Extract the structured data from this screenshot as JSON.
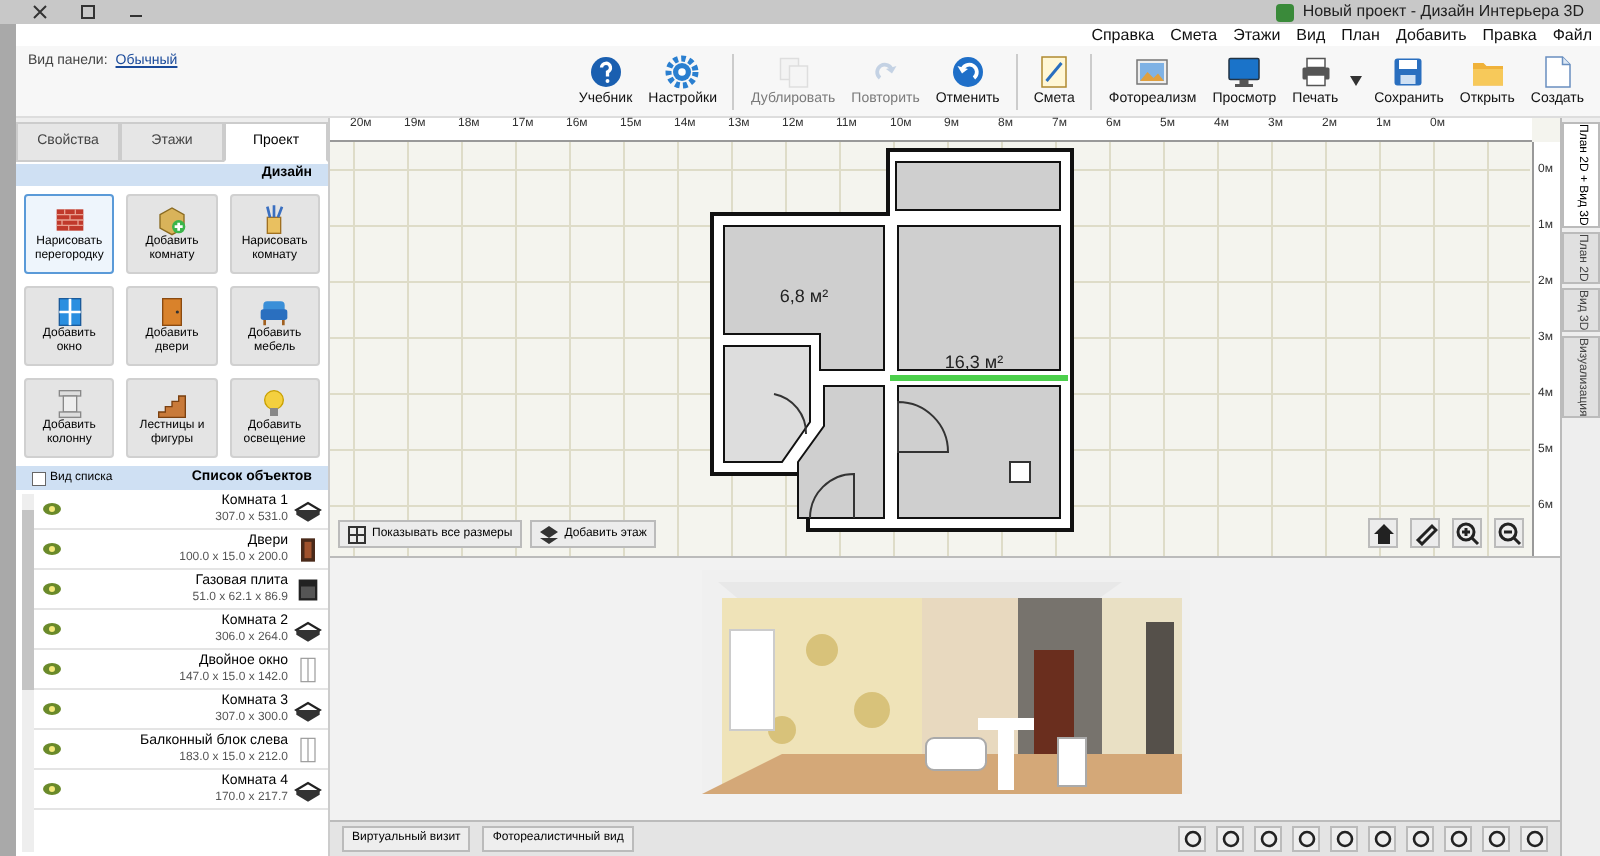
{
  "window": {
    "title": "Новый проект - Дизайн Интерьера 3D"
  },
  "menu": [
    "Справка",
    "Смета",
    "Этажи",
    "Вид",
    "План",
    "Добавить",
    "Правка",
    "Файл"
  ],
  "toolbar": [
    {
      "label": "Учебник",
      "kind": "help",
      "disabled": false
    },
    {
      "label": "Настройки",
      "kind": "settings",
      "disabled": false
    },
    {
      "label": "Дублировать",
      "kind": "duplicate",
      "disabled": true
    },
    {
      "label": "Повторить",
      "kind": "redo",
      "disabled": true
    },
    {
      "label": "Отменить",
      "kind": "undo",
      "disabled": false
    },
    {
      "label": "Смета",
      "kind": "estimate",
      "disabled": false
    },
    {
      "label": "Фотореализм",
      "disabled": false
    },
    {
      "label": "Просмотр",
      "kind": "preview",
      "disabled": false
    },
    {
      "label": "Печать",
      "kind": "print",
      "disabled": false
    },
    {
      "label": "Сохранить",
      "kind": "save",
      "disabled": false
    },
    {
      "label": "Открыть",
      "kind": "open",
      "disabled": false
    },
    {
      "label": "Создать",
      "kind": "new",
      "disabled": false
    }
  ],
  "panel_view": {
    "label": "Вид панели:",
    "value": "Обычный"
  },
  "sidebar": {
    "tabs": [
      {
        "label": "Свойства",
        "selected": false
      },
      {
        "label": "Этажи",
        "selected": false
      },
      {
        "label": "Проект",
        "selected": true
      }
    ],
    "design": {
      "title": "Дизайн",
      "tools": [
        {
          "label": "Нарисовать перегородку",
          "kind": "wall",
          "selected": true
        },
        {
          "label": "Добавить комнату",
          "kind": "add-room",
          "selected": false
        },
        {
          "label": "Нарисовать комнату",
          "kind": "draw-room",
          "selected": false
        },
        {
          "label": "Добавить окно",
          "kind": "window",
          "selected": false
        },
        {
          "label": "Добавить двери",
          "kind": "door",
          "selected": false
        },
        {
          "label": "Добавить мебель",
          "kind": "furniture",
          "selected": false
        },
        {
          "label": "Добавить колонну",
          "kind": "column",
          "selected": false
        },
        {
          "label": "Лестницы и фигуры",
          "kind": "stairs",
          "selected": false
        },
        {
          "label": "Добавить освещение",
          "kind": "light",
          "selected": false
        }
      ]
    },
    "objects": {
      "title": "Список объектов",
      "view_button": "Вид списка",
      "items": [
        {
          "name": "Комната 1",
          "size": "307.0 x 531.0",
          "kind": "room"
        },
        {
          "name": "Двери",
          "size": "100.0 x 15.0 x 200.0",
          "kind": "door"
        },
        {
          "name": "Газовая плита",
          "size": "51.0 x 62.1 x 86.9",
          "kind": "stove"
        },
        {
          "name": "Комната 2",
          "size": "306.0 x 264.0",
          "kind": "room"
        },
        {
          "name": "Двойное окно",
          "size": "147.0 x 15.0 x 142.0",
          "kind": "window"
        },
        {
          "name": "Комната 3",
          "size": "307.0 x 300.0",
          "kind": "room"
        },
        {
          "name": "Балконный блок слева",
          "size": "183.0 x 15.0 x 212.0",
          "kind": "window"
        },
        {
          "name": "Комната 4",
          "size": "170.0 x 217.7",
          "kind": "room"
        }
      ]
    }
  },
  "plan": {
    "ruler_top": [
      "20м",
      "19м",
      "18м",
      "17м",
      "16м",
      "15м",
      "14м",
      "13м",
      "12м",
      "11м",
      "10м",
      "9м",
      "8м",
      "7м",
      "6м",
      "5м",
      "4м",
      "3м",
      "2м",
      "1м",
      "0м"
    ],
    "ruler_side": [
      "0м",
      "1м",
      "2м",
      "3м",
      "4м",
      "5м",
      "6м"
    ],
    "rooms": [
      {
        "area": "6,8 м²"
      },
      {
        "area": "16,3 м²"
      }
    ],
    "buttons": [
      {
        "label": "Показывать все размеры",
        "kind": "dims"
      },
      {
        "label": "Добавить этаж",
        "kind": "floor"
      }
    ]
  },
  "view_tabs": [
    {
      "label": "План 2D + Вид 3D",
      "selected": true
    },
    {
      "label": "План 2D",
      "selected": false
    },
    {
      "label": "Вид 3D",
      "selected": false
    },
    {
      "label": "Визуализация",
      "selected": false
    }
  ],
  "view3d": {
    "buttons": [
      {
        "label": "Виртуальный визит"
      },
      {
        "label": "Фотореалистичный вид"
      }
    ]
  }
}
